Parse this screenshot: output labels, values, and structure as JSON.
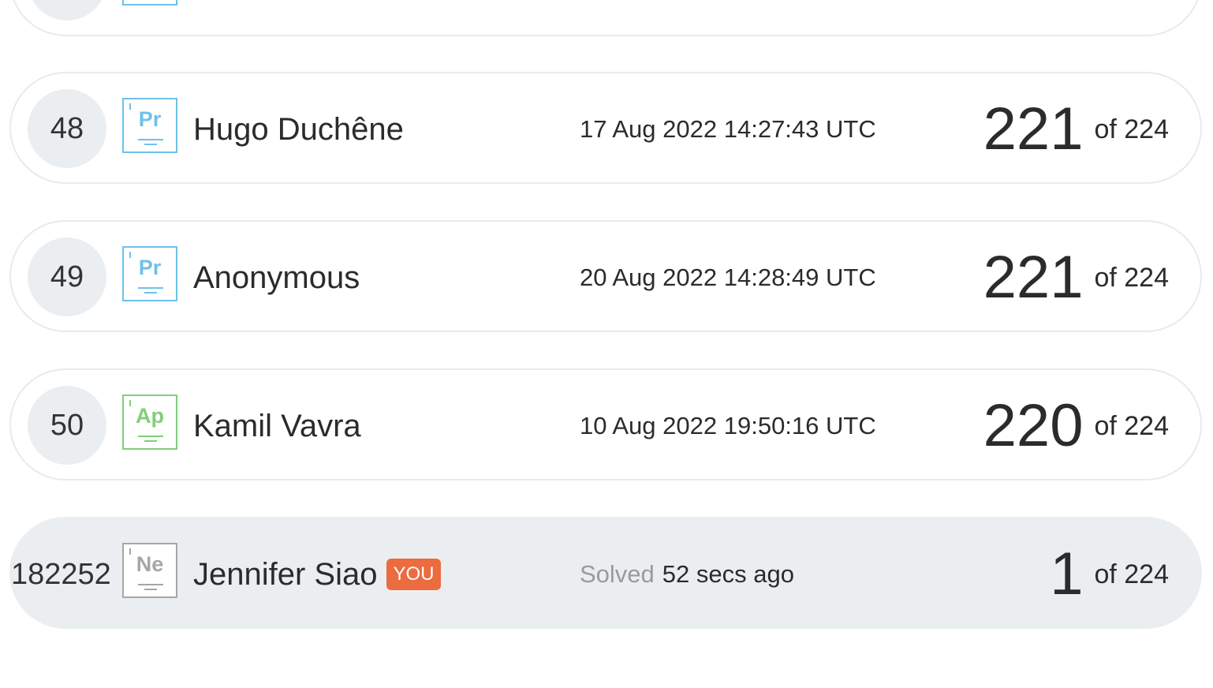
{
  "leaderboard": {
    "rows": [
      {
        "rank": "48",
        "level_symbol": "Pr",
        "level_color": "#6ec1ea",
        "name": "Hugo Duchêne",
        "date": "17 Aug 2022 14:27:43 UTC",
        "score": "221",
        "of_total": "of 224"
      },
      {
        "rank": "49",
        "level_symbol": "Pr",
        "level_color": "#6ec1ea",
        "name": "Anonymous",
        "date": "20 Aug 2022 14:28:49 UTC",
        "score": "221",
        "of_total": "of 224"
      },
      {
        "rank": "50",
        "level_symbol": "Ap",
        "level_color": "#82cf78",
        "name": "Kamil Vavra",
        "date": "10 Aug 2022 19:50:16 UTC",
        "score": "220",
        "of_total": "of 224"
      }
    ],
    "current_user": {
      "rank": "182252",
      "level_symbol": "Ne",
      "level_color": "#a6a6a6",
      "name": "Jennifer Siao",
      "you_tag": "YOU",
      "solved_label": "Solved",
      "solved_time": "52 secs ago",
      "score": "1",
      "of_total": "of 224"
    }
  },
  "colors": {
    "row_border": "#e8eaec",
    "highlight_bg": "#ebeef0",
    "you_tag_bg": "#ec6b3f"
  }
}
